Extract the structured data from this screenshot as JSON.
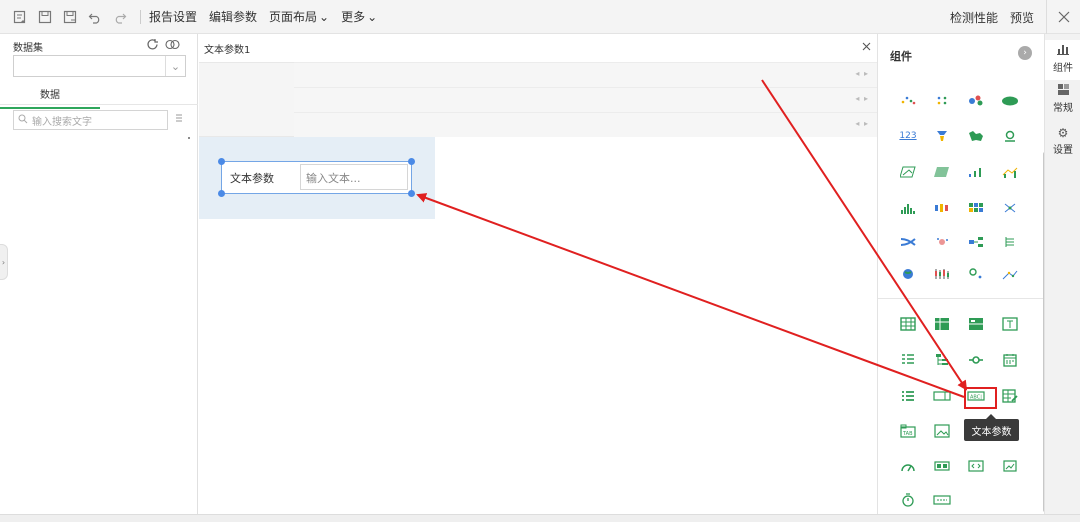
{
  "toolbar": {
    "icons": [
      "new-report-icon",
      "save-icon",
      "save-as-icon",
      "undo-icon",
      "redo-icon"
    ],
    "menus": {
      "report_settings": "报告设置",
      "edit_params": "编辑参数",
      "page_layout": "页面布局",
      "more": "更多"
    },
    "right": {
      "check_performance": "检测性能",
      "preview": "预览"
    }
  },
  "left_panel": {
    "dataset_label": "数据集",
    "dataset_value": "",
    "tab_data": "数据",
    "search_placeholder": "输入搜索文字"
  },
  "center": {
    "tab_title": "文本参数1",
    "widget": {
      "label": "文本参数",
      "input_placeholder": "输入文本..."
    }
  },
  "component_panel": {
    "title": "组件",
    "tooltip": "文本参数",
    "accent_color": "#2e9b55",
    "highlight_color": "#e02020"
  },
  "vtabs": [
    {
      "label": "组件",
      "icon": "bar-chart-icon"
    },
    {
      "label": "常规",
      "icon": "grid-icon"
    },
    {
      "label": "设置",
      "icon": "gear-icon"
    }
  ]
}
